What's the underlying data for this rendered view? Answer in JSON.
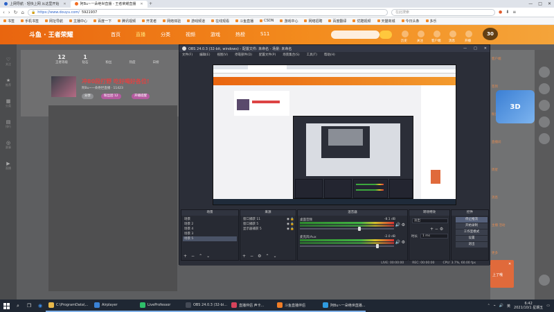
{
  "browser": {
    "tabs": [
      {
        "label": "上网导航 · 轻快上网 从这里开始",
        "active": false
      },
      {
        "label": "阿Bu~一朵绝世直播 - 王者荣耀直播",
        "active": true
      }
    ],
    "new_tab": "+",
    "window_controls": [
      "—",
      "□",
      "✕"
    ],
    "url": {
      "scheme_host": "https://www.douyu.com/",
      "path": "5921937"
    },
    "search_placeholder": "在此搜索",
    "bookmarks": [
      "书签",
      "手机书签",
      "网址导航",
      "主播中心",
      "百度一下",
      "腾讯视频",
      "开发者",
      "网络体验",
      "游戏频道",
      "在线观看",
      "斗鱼直播",
      "CSDN",
      "游戏中心",
      "网络招聘",
      "百度翻译",
      "优酷视频",
      "天猫商城",
      "今日头条",
      "多乐"
    ]
  },
  "douyu": {
    "logo": "斗鱼 · 王者荣耀",
    "nav": [
      "首页",
      "直播",
      "分类",
      "视频",
      "游戏",
      "热榜",
      "S11"
    ],
    "header_icons": [
      "历史",
      "关注",
      "客户端",
      "消息",
      "开播"
    ],
    "timer": "30",
    "rail": [
      "关注",
      "推荐",
      "分类",
      "排行",
      "赛事",
      "直播"
    ],
    "stats": [
      {
        "value": "12",
        "label": "王者等级"
      },
      {
        "value": "1",
        "label": "钻石"
      },
      {
        "value": "",
        "label": "粉丝"
      },
      {
        "value": "",
        "label": "热度"
      },
      {
        "value": "",
        "label": "日榜"
      }
    ],
    "room_title": "冲80段打野 吃好喝好各位!",
    "room_meta": "阿Bu~一朵绝世直播 · 11423",
    "pills": [
      "分享",
      "粉丝团 12",
      "开播提醒"
    ],
    "right_texts": [
      "客户端",
      "签到",
      "粉丝团",
      "直播间",
      "周星",
      "消息",
      "主播 活动",
      "更多"
    ],
    "promo": "3D",
    "popup": "上了哦",
    "popup_close": "✕"
  },
  "obs": {
    "title": "OBS 24.0.3 (32-bit, windows) - 配置文件: 未命名 - 场景: 未命名",
    "window_controls": [
      "—",
      "□",
      "✕"
    ],
    "menu": [
      "文件(F)",
      "编辑(E)",
      "视图(V)",
      "停靠部件(D)",
      "配置文件(P)",
      "场景集合(S)",
      "工具(T)",
      "帮助(H)"
    ],
    "docks": {
      "scenes": {
        "title": "场景",
        "items": [
          "场景",
          "场景 2",
          "场景 4",
          "场景 3",
          "场景 5"
        ],
        "selected": 4
      },
      "sources": {
        "title": "来源",
        "items": [
          "窗口捕获 11",
          "窗口捕获 5",
          "显示器捕获 5"
        ]
      },
      "mixer": {
        "title": "混音器",
        "channels": [
          {
            "name": "桌面音频",
            "db": "-8.1 dB"
          },
          {
            "name": "麦克风/Aux",
            "db": "-2.0 dB"
          }
        ]
      },
      "transitions": {
        "title": "转场特效",
        "type": "淡出",
        "duration_label": "时长",
        "duration": "1 ms"
      },
      "controls": {
        "title": "控件",
        "buttons": [
          "停止推流",
          "开始录制",
          "工作室模式",
          "设置",
          "退出"
        ]
      }
    },
    "status": {
      "live": "LIVE: 00:00:00",
      "rec": "REC: 00:00:00",
      "cpu": "CPU: 3.7%, 60.00 fps"
    }
  },
  "taskbar": {
    "apps": [
      {
        "label": "C:\\ProgramData\\...",
        "color": "#e8b84a"
      },
      {
        "label": "Airplayer",
        "color": "#3a82d6"
      },
      {
        "label": "LiveProfessor",
        "color": "#2fbf6a"
      },
      {
        "label": "OBS 24.0.3 (32-bi...",
        "color": "#444a56"
      },
      {
        "label": "直播伴侣 声卡...",
        "color": "#d6435b"
      },
      {
        "label": "斗鱼直播伴侣",
        "color": "#f07d26"
      },
      {
        "label": "阿Bu~一朵绝世直播...",
        "color": "#2f9be0"
      }
    ],
    "lang": "英",
    "time": "6:42",
    "date": "2021/10/1 星期五"
  }
}
